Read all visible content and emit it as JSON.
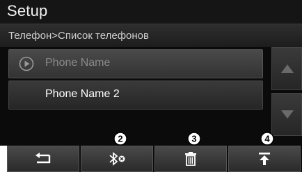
{
  "header": {
    "title": "Setup"
  },
  "breadcrumb": {
    "text": "Телефон>Список телефонов"
  },
  "phone_list": {
    "items": [
      {
        "label": "Phone Name",
        "icon": "play-circle-icon",
        "state": "connected"
      },
      {
        "label": "Phone Name 2"
      }
    ]
  },
  "scroll": {
    "up_icon": "triangle-up-icon",
    "down_icon": "triangle-down-icon"
  },
  "toolbar": {
    "buttons": [
      {
        "icon": "back-arrow-icon"
      },
      {
        "icon": "bluetooth-disconnect-icon",
        "callout": "2"
      },
      {
        "icon": "trash-icon",
        "callout": "3"
      },
      {
        "icon": "move-to-top-icon",
        "callout": "4"
      }
    ]
  },
  "colors": {
    "background": "#0b0b0b",
    "title_bar": "#151515",
    "text": "#ffffff",
    "dim_text": "#8a8a8a"
  }
}
